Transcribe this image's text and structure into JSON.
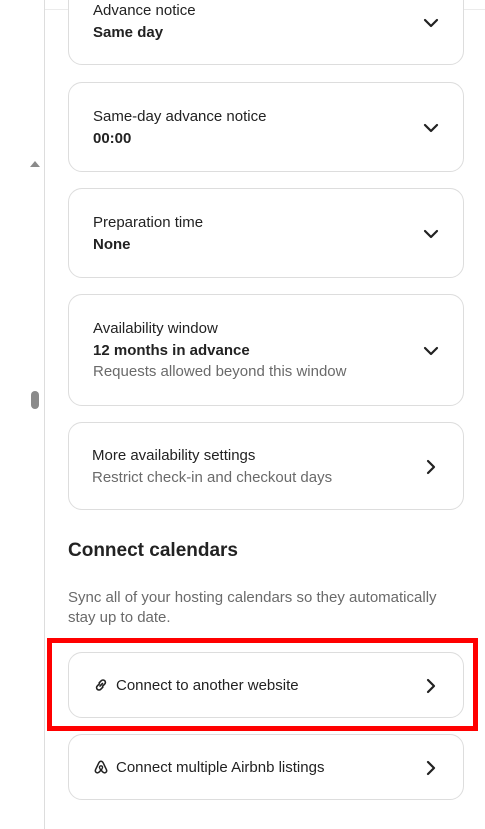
{
  "advance_notice": {
    "label": "Advance notice",
    "value": "Same day"
  },
  "same_day_notice": {
    "label": "Same-day advance notice",
    "value": "00:00"
  },
  "preparation_time": {
    "label": "Preparation time",
    "value": "None"
  },
  "availability_window": {
    "label": "Availability window",
    "value": "12 months in advance",
    "sub": "Requests allowed beyond this window"
  },
  "more_settings": {
    "label": "More availability settings",
    "sub": "Restrict check-in and checkout days"
  },
  "connect_calendars": {
    "title": "Connect calendars",
    "description": "Sync all of your hosting calendars so they automatically stay up to date.",
    "items": [
      {
        "label": "Connect to another website",
        "icon": "link-icon"
      },
      {
        "label": "Connect multiple Airbnb listings",
        "icon": "airbnb-logo-icon"
      }
    ]
  },
  "colors": {
    "highlight": "#ff0000",
    "border": "#dddddd",
    "muted": "#6a6a6a"
  }
}
